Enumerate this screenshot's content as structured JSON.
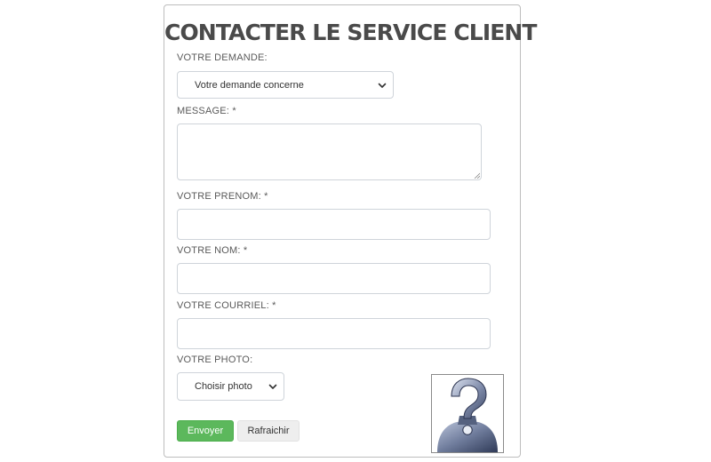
{
  "form": {
    "title": "CONTACTER LE SERVICE CLIENT",
    "request_label": "VOTRE DEMANDE:",
    "request_select_value": "Votre demande concerne",
    "message_label": "MESSAGE: *",
    "message_value": "",
    "firstname_label": "VOTRE PRENOM: *",
    "firstname_value": "",
    "lastname_label": "VOTRE NOM: *",
    "lastname_value": "",
    "email_label": "VOTRE COURRIEL: *",
    "email_value": "",
    "photo_label": "VOTRE PHOTO:",
    "photo_select_value": "Choisir photo",
    "photo_preview_icon": "unknown-person-question-icon"
  },
  "actions": {
    "send_label": "Envoyer",
    "refresh_label": "Rafraichir"
  },
  "colors": {
    "title": "#4a4a4a",
    "send_button": "#5cb85c",
    "refresh_button": "#eeeeee",
    "field_border": "#cfd4da"
  }
}
